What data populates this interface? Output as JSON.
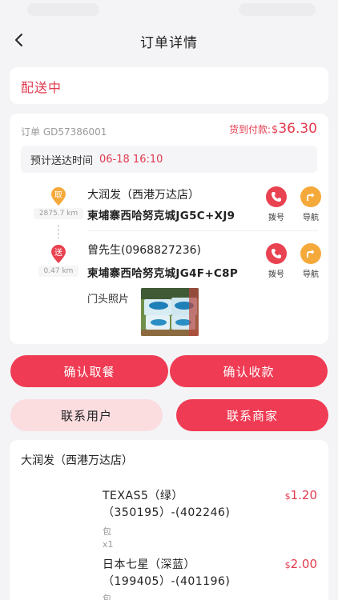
{
  "nav": {
    "title": "订单详情"
  },
  "status": {
    "text": "配送中"
  },
  "order": {
    "number_label": "订单 GD57386001",
    "cod_label": "货到付款:",
    "cod_currency": "$",
    "cod_amount": "36.30",
    "eta_label": "预计送达时间",
    "eta_value": "06-18 16:10"
  },
  "pickup": {
    "badge": "取",
    "distance": "2875.7 km",
    "name": "大润发（西港万达店）",
    "address": "柬埔寨西哈努克城JG5C+XJ9",
    "call_label": "拨号",
    "nav_label": "导航"
  },
  "dropoff": {
    "badge": "送",
    "distance": "0.47 km",
    "name": "曾先生(0968827236)",
    "address": "柬埔寨西哈努克城JG4F+C8P",
    "call_label": "拨号",
    "nav_label": "导航",
    "photo_label": "门头照片"
  },
  "actions": {
    "confirm_pickup": "确认取餐",
    "confirm_receipt": "确认收款",
    "contact_user": "联系用户",
    "contact_merchant": "联系商家"
  },
  "items": {
    "store": "大润发（西港万达店）",
    "list": [
      {
        "name": "TEXAS5（绿）（350195）-(402246)",
        "unit": "包",
        "qty": "x1",
        "currency": "$",
        "price": "1.20"
      },
      {
        "name": "日本七星（深蓝）（199405）-(401196)",
        "unit": "包",
        "currency": "$",
        "price": "2.00"
      }
    ]
  },
  "colors": {
    "accent_red": "#ef3b53",
    "price_red": "#e23a4e",
    "nav_orange": "#f5a93a",
    "pink_button": "#fbdde0"
  }
}
